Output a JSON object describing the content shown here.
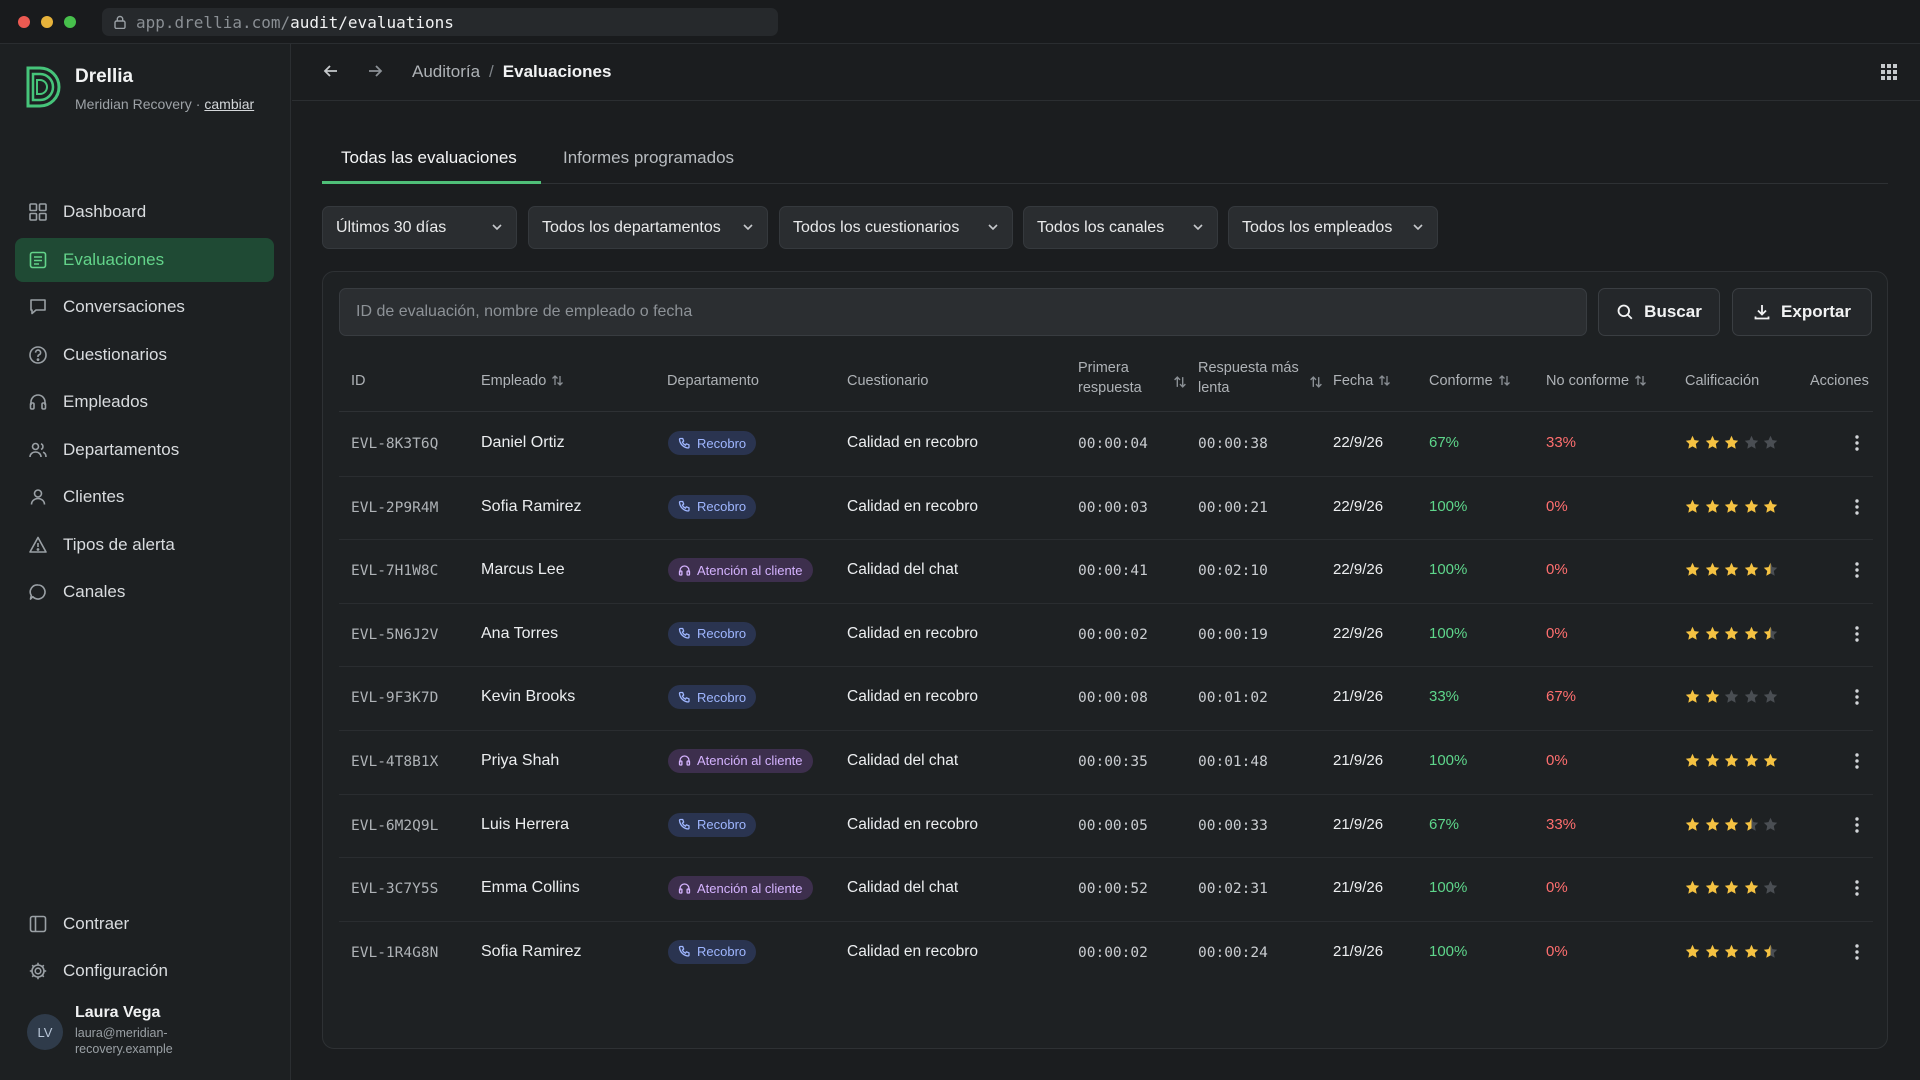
{
  "browser": {
    "url_host": "app.drellia.com/",
    "url_path": "audit/evaluations"
  },
  "brand": {
    "name": "Drellia",
    "org": "Meridian Recovery",
    "switch_label": "cambiar"
  },
  "sidebar": {
    "items": [
      {
        "label": "Dashboard",
        "icon": "dashboard-icon"
      },
      {
        "label": "Evaluaciones",
        "icon": "evaluations-icon",
        "active": true
      },
      {
        "label": "Conversaciones",
        "icon": "chat-icon"
      },
      {
        "label": "Cuestionarios",
        "icon": "question-icon"
      },
      {
        "label": "Empleados",
        "icon": "headset-icon"
      },
      {
        "label": "Departamentos",
        "icon": "users-icon"
      },
      {
        "label": "Clientes",
        "icon": "user-icon"
      },
      {
        "label": "Tipos de alerta",
        "icon": "alert-icon"
      },
      {
        "label": "Canales",
        "icon": "channel-icon"
      }
    ],
    "collapse_label": "Contraer",
    "settings_label": "Configuración",
    "user": {
      "initials": "LV",
      "name": "Laura Vega",
      "email": "laura@meridian-recovery.example"
    }
  },
  "header": {
    "breadcrumb": {
      "parent": "Auditoría",
      "separator": "/",
      "current": "Evaluaciones"
    }
  },
  "tabs": [
    {
      "label": "Todas las evaluaciones",
      "active": true
    },
    {
      "label": "Informes programados"
    }
  ],
  "filters": [
    "Últimos 30 días",
    "Todos los departamentos",
    "Todos los cuestionarios",
    "Todos los canales",
    "Todos los empleados"
  ],
  "search": {
    "placeholder": "ID de evaluación, nombre de empleado o fecha",
    "button": "Buscar"
  },
  "export_label": "Exportar",
  "table": {
    "columns": {
      "id": "ID",
      "employee": "Empleado",
      "department": "Departamento",
      "questionnaire": "Cuestionario",
      "first_response": "Primera respuesta",
      "slowest_response": "Respuesta más lenta",
      "date": "Fecha",
      "compliant": "Conforme",
      "noncompliant": "No conforme",
      "rating": "Calificación",
      "actions": "Acciones"
    },
    "rows": [
      {
        "id": "EVL-8K3T6Q",
        "employee": "Daniel Ortiz",
        "department": "Recobro",
        "dept_type": "rec",
        "questionnaire": "Calidad en recobro",
        "first": "00:00:04",
        "slowest": "00:00:38",
        "date": "22/9/26",
        "ok": "67%",
        "bad": "33%",
        "rating": 3
      },
      {
        "id": "EVL-2P9R4M",
        "employee": "Sofia Ramirez",
        "department": "Recobro",
        "dept_type": "rec",
        "questionnaire": "Calidad en recobro",
        "first": "00:00:03",
        "slowest": "00:00:21",
        "date": "22/9/26",
        "ok": "100%",
        "bad": "0%",
        "rating": 5
      },
      {
        "id": "EVL-7H1W8C",
        "employee": "Marcus Lee",
        "department": "Atención al cliente",
        "dept_type": "att",
        "questionnaire": "Calidad del chat",
        "first": "00:00:41",
        "slowest": "00:02:10",
        "date": "22/9/26",
        "ok": "100%",
        "bad": "0%",
        "rating": 4.5
      },
      {
        "id": "EVL-5N6J2V",
        "employee": "Ana Torres",
        "department": "Recobro",
        "dept_type": "rec",
        "questionnaire": "Calidad en recobro",
        "first": "00:00:02",
        "slowest": "00:00:19",
        "date": "22/9/26",
        "ok": "100%",
        "bad": "0%",
        "rating": 4.5
      },
      {
        "id": "EVL-9F3K7D",
        "employee": "Kevin Brooks",
        "department": "Recobro",
        "dept_type": "rec",
        "questionnaire": "Calidad en recobro",
        "first": "00:00:08",
        "slowest": "00:01:02",
        "date": "21/9/26",
        "ok": "33%",
        "bad": "67%",
        "rating": 2
      },
      {
        "id": "EVL-4T8B1X",
        "employee": "Priya Shah",
        "department": "Atención al cliente",
        "dept_type": "att",
        "questionnaire": "Calidad del chat",
        "first": "00:00:35",
        "slowest": "00:01:48",
        "date": "21/9/26",
        "ok": "100%",
        "bad": "0%",
        "rating": 5
      },
      {
        "id": "EVL-6M2Q9L",
        "employee": "Luis Herrera",
        "department": "Recobro",
        "dept_type": "rec",
        "questionnaire": "Calidad en recobro",
        "first": "00:00:05",
        "slowest": "00:00:33",
        "date": "21/9/26",
        "ok": "67%",
        "bad": "33%",
        "rating": 3.5
      },
      {
        "id": "EVL-3C7Y5S",
        "employee": "Emma Collins",
        "department": "Atención al cliente",
        "dept_type": "att",
        "questionnaire": "Calidad del chat",
        "first": "00:00:52",
        "slowest": "00:02:31",
        "date": "21/9/26",
        "ok": "100%",
        "bad": "0%",
        "rating": 4
      },
      {
        "id": "EVL-1R4G8N",
        "employee": "Sofia Ramirez",
        "department": "Recobro",
        "dept_type": "rec",
        "questionnaire": "Calidad en recobro",
        "first": "00:00:02",
        "slowest": "00:00:24",
        "date": "21/9/26",
        "ok": "100%",
        "bad": "0%",
        "rating": 4.5
      }
    ]
  },
  "colors": {
    "accent": "#4fbf78",
    "active_bg": "#1f4a34",
    "ok": "#5ed68b",
    "bad": "#ff6f6f",
    "star": "#f5c242"
  }
}
